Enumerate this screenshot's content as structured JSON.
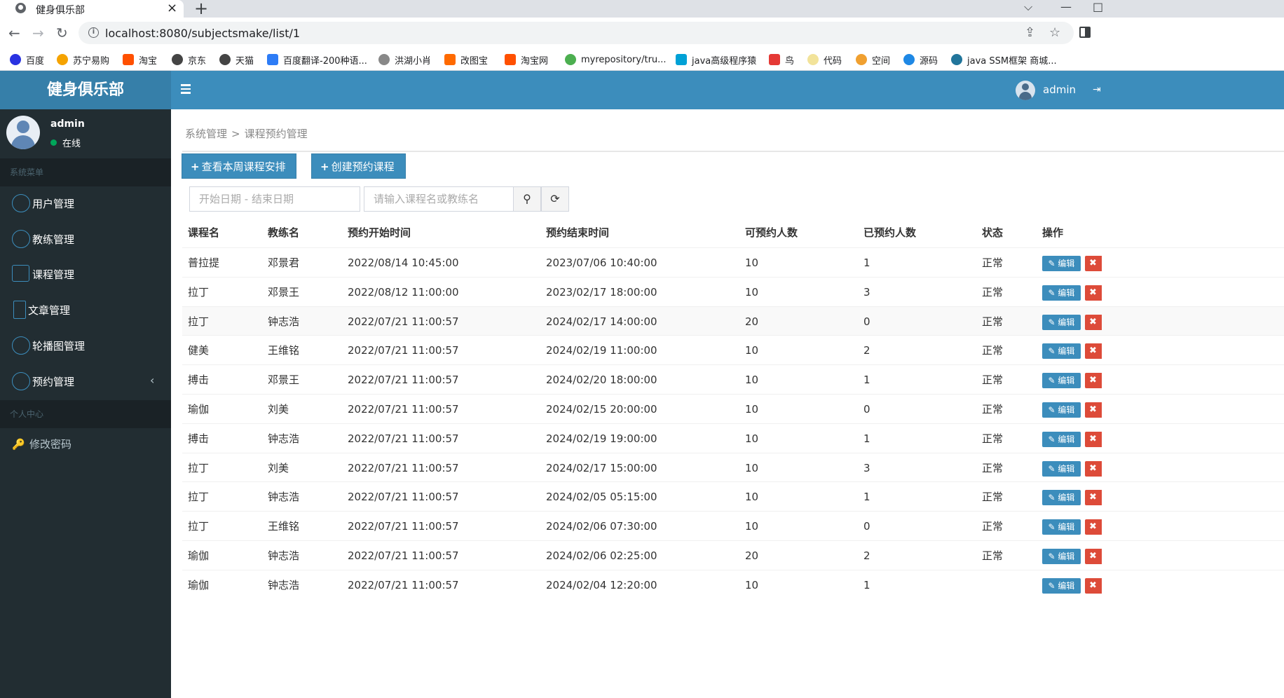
{
  "browser": {
    "tab_title": "健身俱乐部",
    "url": "localhost:8080/subjectsmake/list/1",
    "bookmarks": [
      {
        "label": "百度",
        "color": "#2932e1"
      },
      {
        "label": "苏宁易购",
        "color": "#f5a300"
      },
      {
        "label": "淘宝",
        "color": "#ff5000"
      },
      {
        "label": "京东",
        "color": "#444444"
      },
      {
        "label": "天猫",
        "color": "#444444"
      },
      {
        "label": "百度翻译-200种语...",
        "color": "#2d7cf6"
      },
      {
        "label": "洪湖小肖",
        "color": "#888888"
      },
      {
        "label": "改图宝",
        "color": "#ff6a00"
      },
      {
        "label": "淘宝网",
        "color": "#ff5000"
      },
      {
        "label": "myrepository/tru...",
        "color": "#4caf50"
      },
      {
        "label": "java高级程序猿",
        "color": "#00a1d6"
      },
      {
        "label": "鸟",
        "color": "#e53935"
      },
      {
        "label": "代码",
        "color": "#f2e39a"
      },
      {
        "label": "空间",
        "color": "#f0a030"
      },
      {
        "label": "源码",
        "color": "#1e88e5"
      },
      {
        "label": "java SSM框架 商城...",
        "color": "#21759b"
      }
    ]
  },
  "header": {
    "logo": "健身俱乐部",
    "username": "admin"
  },
  "sidebar": {
    "user_name": "admin",
    "user_status": "在线",
    "section_system": "系统菜单",
    "items": [
      {
        "label": "用户管理",
        "icon": "user-circle-icon"
      },
      {
        "label": "教练管理",
        "icon": "coach-circle-icon"
      },
      {
        "label": "课程管理",
        "icon": "calendar-icon"
      },
      {
        "label": "文章管理",
        "icon": "document-icon"
      },
      {
        "label": "轮播图管理",
        "icon": "image-circle-icon"
      },
      {
        "label": "预约管理",
        "icon": "clock-circle-icon"
      }
    ],
    "section_personal": "个人中心",
    "change_password": "修改密码"
  },
  "breadcrumb": {
    "root": "系统管理",
    "separator": ">",
    "current": "课程预约管理"
  },
  "actions": {
    "weekly_schedule": "查看本周课程安排",
    "create_booking": "创建预约课程"
  },
  "filters": {
    "date_range_placeholder": "开始日期  - 结束日期",
    "search_placeholder": "请输入课程名或教练名"
  },
  "table": {
    "columns": [
      "课程名",
      "教练名",
      "预约开始时间",
      "预约结束时间",
      "可预约人数",
      "已预约人数",
      "状态",
      "操作"
    ],
    "edit_label": "编辑",
    "delete_label": "✖",
    "rows": [
      {
        "course": "普拉提",
        "coach": "邓景君",
        "start": "2022/08/14 10:45:00",
        "end": "2023/07/06 10:40:00",
        "capacity": "10",
        "booked": "1",
        "status": "正常"
      },
      {
        "course": "拉丁",
        "coach": "邓景王",
        "start": "2022/08/12 11:00:00",
        "end": "2023/02/17 18:00:00",
        "capacity": "10",
        "booked": "3",
        "status": "正常"
      },
      {
        "course": "拉丁",
        "coach": "钟志浩",
        "start": "2022/07/21 11:00:57",
        "end": "2024/02/17 14:00:00",
        "capacity": "20",
        "booked": "0",
        "status": "正常"
      },
      {
        "course": "健美",
        "coach": "王维铭",
        "start": "2022/07/21 11:00:57",
        "end": "2024/02/19 11:00:00",
        "capacity": "10",
        "booked": "2",
        "status": "正常"
      },
      {
        "course": "搏击",
        "coach": "邓景王",
        "start": "2022/07/21 11:00:57",
        "end": "2024/02/20 18:00:00",
        "capacity": "10",
        "booked": "1",
        "status": "正常"
      },
      {
        "course": "瑜伽",
        "coach": "刘美",
        "start": "2022/07/21 11:00:57",
        "end": "2024/02/15 20:00:00",
        "capacity": "10",
        "booked": "0",
        "status": "正常"
      },
      {
        "course": "搏击",
        "coach": "钟志浩",
        "start": "2022/07/21 11:00:57",
        "end": "2024/02/19 19:00:00",
        "capacity": "10",
        "booked": "1",
        "status": "正常"
      },
      {
        "course": "拉丁",
        "coach": "刘美",
        "start": "2022/07/21 11:00:57",
        "end": "2024/02/17 15:00:00",
        "capacity": "10",
        "booked": "3",
        "status": "正常"
      },
      {
        "course": "拉丁",
        "coach": "钟志浩",
        "start": "2022/07/21 11:00:57",
        "end": "2024/02/05 05:15:00",
        "capacity": "10",
        "booked": "1",
        "status": "正常"
      },
      {
        "course": "拉丁",
        "coach": "王维铭",
        "start": "2022/07/21 11:00:57",
        "end": "2024/02/06 07:30:00",
        "capacity": "10",
        "booked": "0",
        "status": "正常"
      },
      {
        "course": "瑜伽",
        "coach": "钟志浩",
        "start": "2022/07/21 11:00:57",
        "end": "2024/02/06 02:25:00",
        "capacity": "20",
        "booked": "2",
        "status": "正常"
      },
      {
        "course": "瑜伽",
        "coach": "钟志浩",
        "start": "2022/07/21 11:00:57",
        "end": "2024/02/04 12:20:00",
        "capacity": "10",
        "booked": "1",
        "status": ""
      }
    ]
  }
}
